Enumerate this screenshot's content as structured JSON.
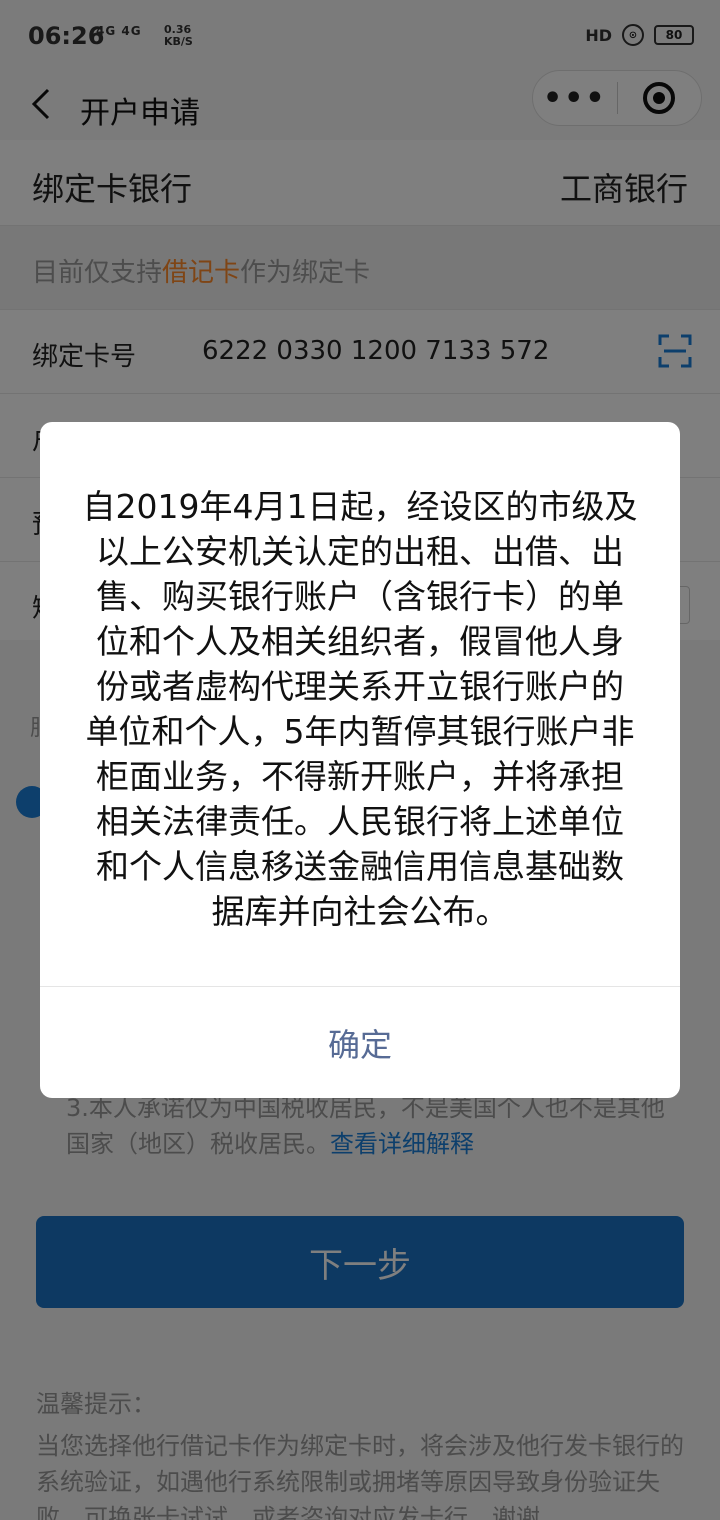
{
  "status_bar": {
    "time": "06:26",
    "signal": "4G 4G",
    "speed_value": "0.36",
    "speed_unit": "KB/S",
    "hd": "HD",
    "battery": "80"
  },
  "nav": {
    "title": "开户申请",
    "more_icon": "•••"
  },
  "form": {
    "bank_label": "绑定卡银行",
    "bank_value": "工商银行",
    "notice_prefix": "目前仅支持",
    "notice_highlight": "借记卡",
    "notice_suffix": "作为绑定卡",
    "card_label": "绑定卡号",
    "card_value": "6222 0330 1200 7133 572",
    "partial_label_1": "户",
    "partial_label_2": "预",
    "partial_label_3": "短",
    "partial_label_4": "服"
  },
  "terms": {
    "text": "3.本人承诺仅为中国税收居民，不是美国个人也不是其他国家（地区）税收居民。",
    "link": "查看详细解释"
  },
  "next_button": "下一步",
  "tip": {
    "title": "温馨提示：",
    "body": "当您选择他行借记卡作为绑定卡时，将会涉及他行发卡银行的系统验证，如遇他行系统限制或拥堵等原因导致身份验证失败，可换张卡试试，或者咨询对应发卡行，谢谢"
  },
  "modal": {
    "message": "自2019年4月1日起，经设区的市级及以上公安机关认定的出租、出借、出售、购买银行账户（含银行卡）的单位和个人及相关组织者，假冒他人身份或者虚构代理关系开立银行账户的单位和个人，5年内暂停其银行账户非柜面业务，不得新开账户，并将承担相关法律责任。人民银行将上述单位和个人信息移送金融信用信息基础数据库并向社会公布。",
    "confirm": "确定"
  },
  "colors": {
    "accent": "#1a72c4",
    "highlight": "#ff8a2a",
    "confirm": "#576b95"
  }
}
